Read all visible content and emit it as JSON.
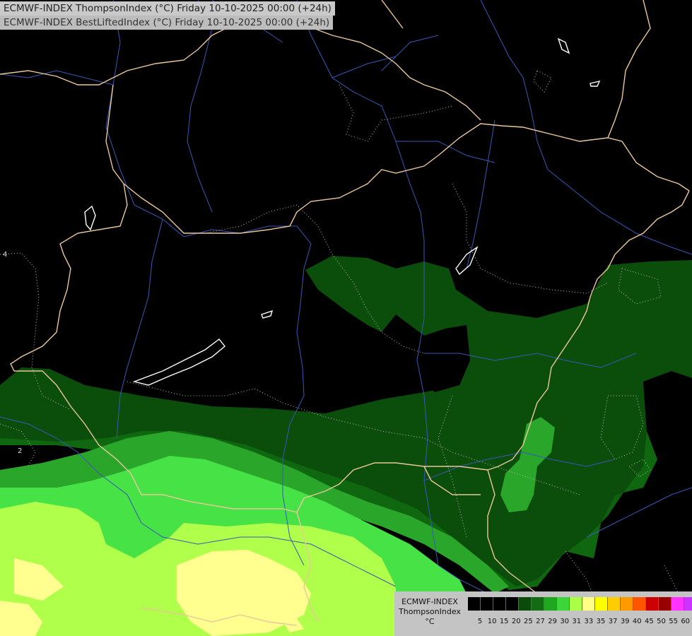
{
  "header": {
    "line1": "ECMWF-INDEX ThompsonIndex (°C) Friday 10-10-2025 00:00 (+24h)",
    "line2": "ECMWF-INDEX BestLiftedIndex (°C) Friday 10-10-2025 00:00 (+24h)"
  },
  "legend": {
    "model": "ECMWF-INDEX",
    "parameter": "ThompsonIndex",
    "unit": "°C",
    "levels": [
      "5",
      "10",
      "15",
      "20",
      "25",
      "27",
      "29",
      "30",
      "31",
      "33",
      "35",
      "37",
      "39",
      "40",
      "45",
      "50",
      "55",
      "60"
    ],
    "colors": [
      "#000000",
      "#000000",
      "#000000",
      "#000000",
      "#0a4a0a",
      "#136b13",
      "#1fa81f",
      "#3cd63c",
      "#aaff44",
      "#ffff88",
      "#ffff00",
      "#ffcc00",
      "#ff9900",
      "#ff5500",
      "#cc0000",
      "#990000",
      "#ff33ff",
      "#cc33ff",
      "#6600ff",
      "#0000ff"
    ]
  },
  "contour_labels": [
    "4",
    "2"
  ],
  "colors": {
    "border": "#e9c79a",
    "river": "#3a57b8",
    "dark_green": "#0b4d0b",
    "mid_green": "#0f6a0f",
    "green": "#2aa62a",
    "bright_green": "#46e246",
    "yellow_green": "#b0ff4a",
    "pale_yellow": "#ffff90"
  }
}
